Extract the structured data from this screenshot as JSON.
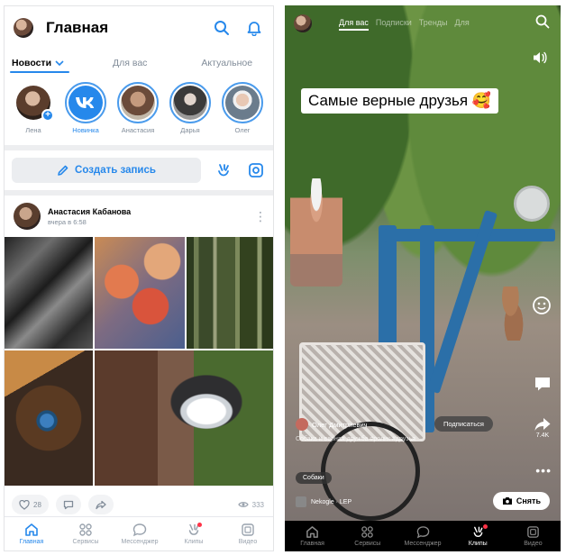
{
  "left": {
    "header": {
      "title": "Главная"
    },
    "tabs": [
      {
        "label": "Новости",
        "active": true
      },
      {
        "label": "Для вас",
        "active": false
      },
      {
        "label": "Актуальное",
        "active": false
      }
    ],
    "stories": [
      {
        "label": "Лена"
      },
      {
        "label": "Новинка"
      },
      {
        "label": "Анастасия"
      },
      {
        "label": "Дарья"
      },
      {
        "label": "Олег"
      }
    ],
    "compose": {
      "label": "Создать запись"
    },
    "post": {
      "author": "Анастасия Кабанова",
      "time": "вчера в 6:58",
      "likes": "28",
      "views": "333"
    },
    "nav": [
      {
        "label": "Главная",
        "icon": "home-icon",
        "active": true
      },
      {
        "label": "Сервисы",
        "icon": "services-icon",
        "active": false
      },
      {
        "label": "Мессенджер",
        "icon": "messenger-icon",
        "active": false
      },
      {
        "label": "Клипы",
        "icon": "clips-icon",
        "active": false
      },
      {
        "label": "Видео",
        "icon": "video-icon",
        "active": false
      }
    ]
  },
  "right": {
    "tabs": [
      {
        "label": "Для вас",
        "active": true
      },
      {
        "label": "Подписки",
        "active": false
      },
      {
        "label": "Тренды",
        "active": false
      },
      {
        "label": "Для",
        "active": false
      }
    ],
    "caption": "Самые верные друзья 🥰",
    "author": "Олег Дмитриевич",
    "subscribe": "Подписаться",
    "description": "Собака и верная дружба #ролик #друзья",
    "tag": "Собаки",
    "music": "Nekogle · LEP",
    "shoot": "Снять",
    "side": {
      "likes": "",
      "comments": "",
      "shares": "7.4K"
    },
    "nav": [
      {
        "label": "Главная",
        "active": false
      },
      {
        "label": "Сервисы",
        "active": false
      },
      {
        "label": "Мессенджер",
        "active": false
      },
      {
        "label": "Клипы",
        "active": true
      },
      {
        "label": "Видео",
        "active": false
      }
    ]
  },
  "colors": {
    "accent": "#2688eb",
    "badge": "#ff3347"
  }
}
